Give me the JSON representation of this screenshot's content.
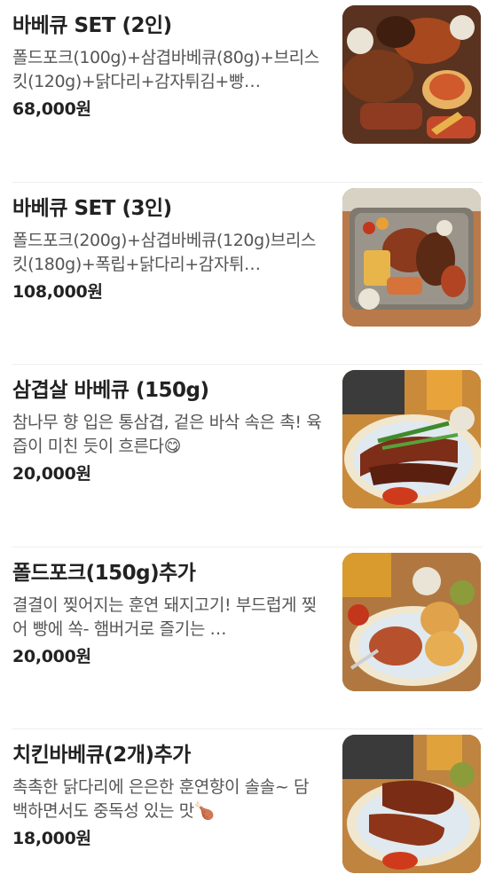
{
  "menu": {
    "items": [
      {
        "name": "바베큐 SET (2인)",
        "description": "폴드포크(100g)+삼겹바베큐(80g)+브리스킷(120g)+닭다리+감자튀김+빵…",
        "price": "68,000원",
        "photo": "bbq-platter-2-photo"
      },
      {
        "name": "바베큐 SET (3인)",
        "description": "폴드포크(200g)+삼겹바베큐(120g)브리스킷(180g)+폭립+닭다리+감자튀…",
        "price": "108,000원",
        "photo": "bbq-platter-3-photo"
      },
      {
        "name": "삼겹살 바베큐 (150g)",
        "description": "참나무 향 입은 통삼겹, 겉은 바삭 속은 촉! 육즙이 미친 듯이 흐른다😋",
        "price": "20,000원",
        "photo": "pork-belly-photo"
      },
      {
        "name": "폴드포크(150g)추가",
        "description": "결결이 찢어지는 훈연 돼지고기! 부드럽게 찢어 빵에 쏙- 햄버거로 즐기는 …",
        "price": "20,000원",
        "photo": "pulled-pork-photo"
      },
      {
        "name": "치킨바베큐(2개)추가",
        "description": "촉촉한 닭다리에 은은한 훈연향이 솔솔~ 담백하면서도 중독성 있는 맛🍗",
        "price": "18,000원",
        "photo": "chicken-bbq-photo"
      }
    ]
  }
}
